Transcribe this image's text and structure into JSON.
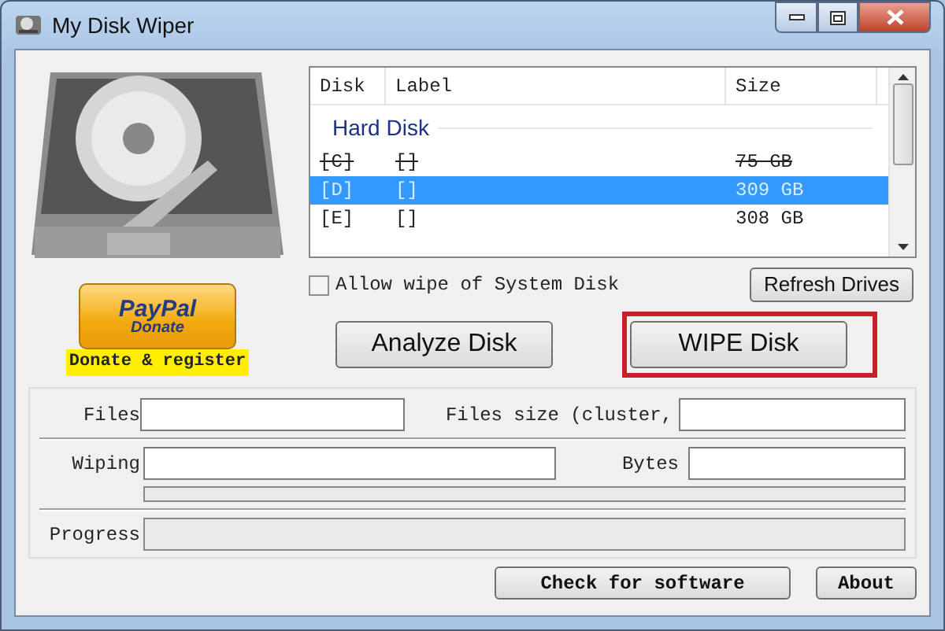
{
  "window": {
    "title": "My Disk Wiper"
  },
  "donate": {
    "button_brand": "PayPal",
    "button_label": "Donate",
    "caption": "Donate & register"
  },
  "disk_list": {
    "columns": [
      "Disk",
      "Label",
      "Size"
    ],
    "group": "Hard Disk",
    "rows": [
      {
        "disk": "[C]",
        "label": "[]",
        "size": "75 GB",
        "disabled": true,
        "selected": false
      },
      {
        "disk": "[D]",
        "label": "[]",
        "size": "309 GB",
        "disabled": false,
        "selected": true
      },
      {
        "disk": "[E]",
        "label": "[]",
        "size": "308 GB",
        "disabled": false,
        "selected": false
      }
    ]
  },
  "allow_system_disk": {
    "label": "Allow wipe of System Disk",
    "checked": false
  },
  "refresh_button": "Refresh Drives",
  "actions": [
    {
      "label": "Analyze Disk",
      "highlighted": false
    },
    {
      "label": "WIPE Disk",
      "highlighted": true
    }
  ],
  "status": {
    "files_label": "Files",
    "files_size_label": "Files size (cluster,",
    "wiping_label": "Wiping",
    "bytes_label": "Bytes",
    "wipe_bar": {
      "level": 0
    },
    "progress_label": "Progress",
    "progress_bar": {
      "level": 0
    }
  },
  "footer_buttons": [
    "Check for software",
    "About"
  ]
}
